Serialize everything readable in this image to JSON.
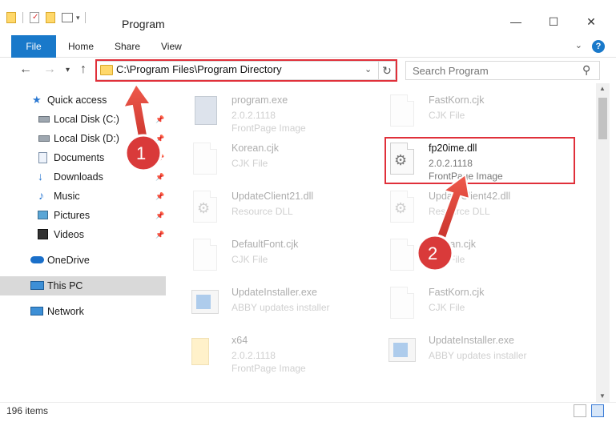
{
  "window": {
    "title": "Program",
    "minimize": "—",
    "maximize": "☐",
    "close": "✕"
  },
  "ribbon": {
    "tabs": [
      "File",
      "Home",
      "Share",
      "View"
    ],
    "help": "?"
  },
  "address": {
    "path": "C:\\Program Files\\Program Directory",
    "search_placeholder": "Search Program"
  },
  "sidebar": {
    "items": [
      {
        "label": "Quick access",
        "icon": "star-icon"
      },
      {
        "label": "Local Disk (C:)",
        "icon": "drive-icon",
        "pinned": true
      },
      {
        "label": "Local Disk (D:)",
        "icon": "drive-icon",
        "pinned": true
      },
      {
        "label": "Documents",
        "icon": "documents-icon",
        "pinned": true
      },
      {
        "label": "Downloads",
        "icon": "download-icon",
        "pinned": true
      },
      {
        "label": "Music",
        "icon": "music-icon",
        "pinned": true
      },
      {
        "label": "Pictures",
        "icon": "pictures-icon",
        "pinned": true
      },
      {
        "label": "Videos",
        "icon": "videos-icon",
        "pinned": true
      },
      {
        "label": "OneDrive",
        "icon": "cloud-icon"
      },
      {
        "label": "This PC",
        "icon": "computer-icon",
        "selected": true
      },
      {
        "label": "Network",
        "icon": "network-icon"
      }
    ]
  },
  "files": [
    {
      "name": "program.exe",
      "line2": "2.0.2.1118",
      "line3": "FrontPage Image",
      "kind": "exe"
    },
    {
      "name": "FastKorn.cjk",
      "line2": "CJK File",
      "line3": "",
      "kind": "page"
    },
    {
      "name": "Korean.cjk",
      "line2": "CJK File",
      "line3": "",
      "kind": "page"
    },
    {
      "name": "fp20ime.dll",
      "line2": "2.0.2.1118",
      "line3": "FrontPage Image",
      "kind": "dll",
      "highlighted": true
    },
    {
      "name": "UpdateClient21.dll",
      "line2": "Resource DLL",
      "line3": "",
      "kind": "dll"
    },
    {
      "name": "UpdateClient42.dll",
      "line2": "Resource DLL",
      "line3": "",
      "kind": "dll"
    },
    {
      "name": "DefaultFont.cjk",
      "line2": "CJK File",
      "line3": "",
      "kind": "page"
    },
    {
      "name": "Korean.cjk",
      "line2": "CJK File",
      "line3": "",
      "kind": "page"
    },
    {
      "name": "UpdateInstaller.exe",
      "line2": "ABBY updates installer",
      "line3": "",
      "kind": "installer"
    },
    {
      "name": "FastKorn.cjk",
      "line2": "CJK File",
      "line3": "",
      "kind": "page"
    },
    {
      "name": "x64",
      "line2": "2.0.2.1118",
      "line3": "FrontPage Image",
      "kind": "folder"
    },
    {
      "name": "UpdateInstaller.exe",
      "line2": "ABBY updates installer",
      "line3": "",
      "kind": "installer"
    }
  ],
  "callouts": {
    "one": "1",
    "two": "2"
  },
  "status": {
    "items": "196 items"
  },
  "colors": {
    "accent": "#1979ca",
    "highlight": "#e0303a",
    "callout_circle": "#d93a3a"
  }
}
